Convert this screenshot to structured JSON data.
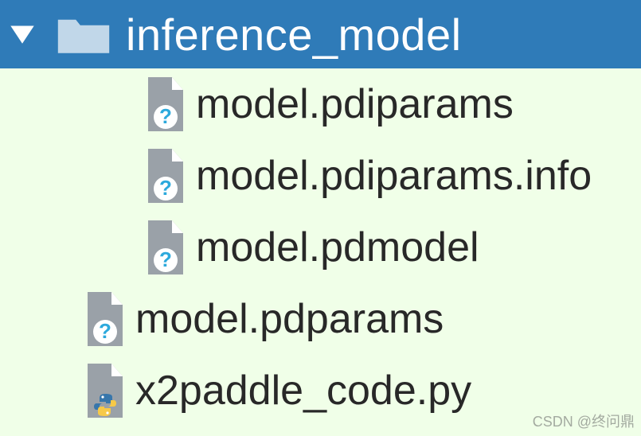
{
  "folder": {
    "label": "inference_model",
    "expanded": true
  },
  "files": [
    {
      "label": "model.pdiparams",
      "icon": "unknown-file-icon",
      "depth": 1
    },
    {
      "label": "model.pdiparams.info",
      "icon": "unknown-file-icon",
      "depth": 1
    },
    {
      "label": "model.pdmodel",
      "icon": "unknown-file-icon",
      "depth": 1
    },
    {
      "label": "model.pdparams",
      "icon": "unknown-file-icon",
      "depth": 0
    },
    {
      "label": "x2paddle_code.py",
      "icon": "python-file-icon",
      "depth": 0
    }
  ],
  "colors": {
    "folder_bg": "#2f7bb8",
    "panel_bg": "#f0ffe8",
    "file_gray": "#9aa1a8",
    "accent_blue": "#2ca9dc",
    "python_yellow": "#f7c948",
    "python_blue": "#3776ab"
  },
  "watermark": "CSDN @终问鼎"
}
